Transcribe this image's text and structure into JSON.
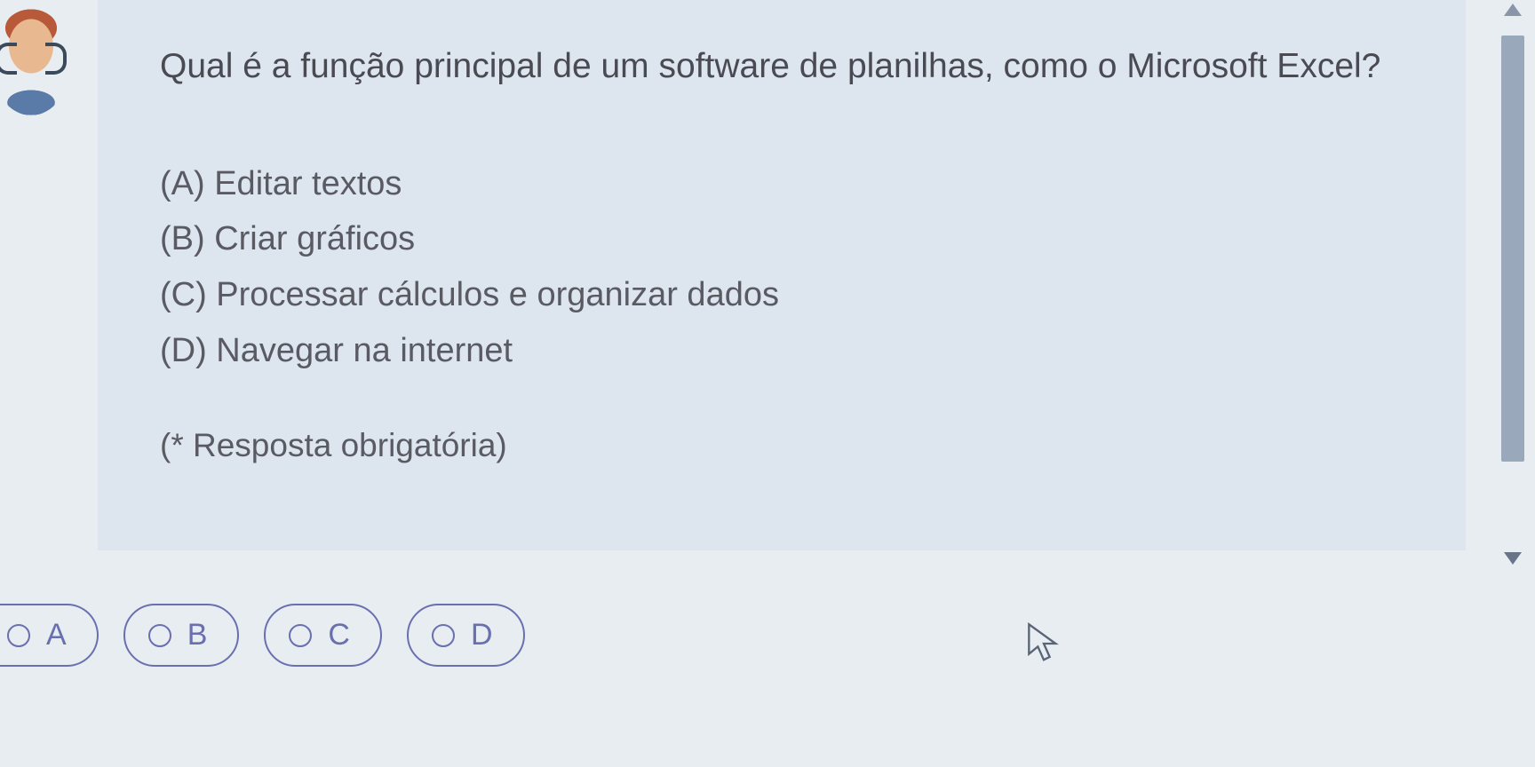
{
  "question": {
    "prompt": "Qual é a função principal de um software de planilhas, como o Microsoft Excel?",
    "options": {
      "a": "(A) Editar textos",
      "b": "(B) Criar gráficos",
      "c": "(C) Processar cálculos e organizar dados",
      "d": "(D) Navegar na internet"
    },
    "required_note": "(* Resposta obrigatória)"
  },
  "answers": {
    "a": "A",
    "b": "B",
    "c": "C",
    "d": "D"
  }
}
